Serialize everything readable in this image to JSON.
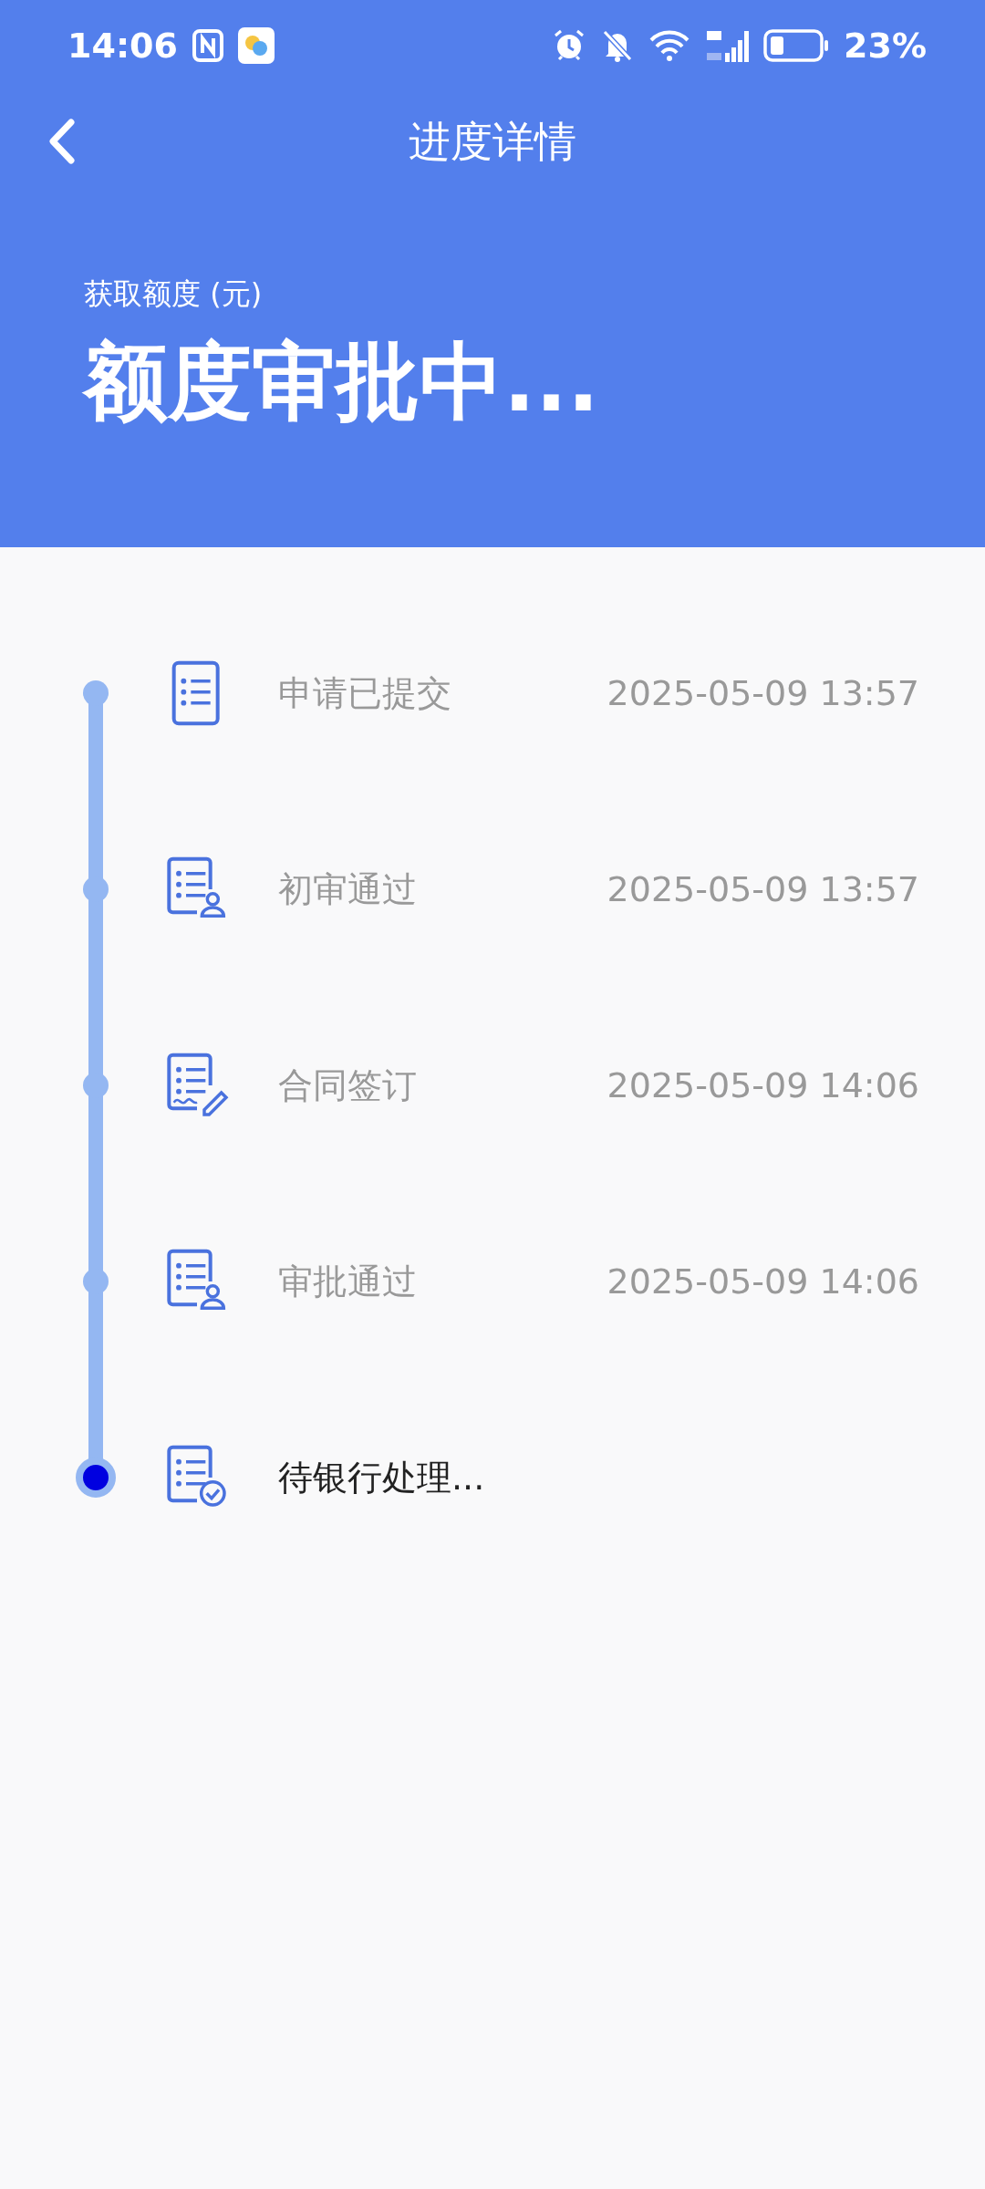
{
  "status_bar": {
    "time": "14:06",
    "battery": "23%"
  },
  "header": {
    "title": "进度详情",
    "label": "获取额度 (元)",
    "status": "额度审批中..."
  },
  "steps": [
    {
      "kind": "list",
      "title": "申请已提交",
      "time": "2025-05-09 13:57",
      "current": false
    },
    {
      "kind": "person",
      "title": "初审通过",
      "time": "2025-05-09 13:57",
      "current": false
    },
    {
      "kind": "sign",
      "title": "合同签订",
      "time": "2025-05-09 14:06",
      "current": false
    },
    {
      "kind": "person",
      "title": "审批通过",
      "time": "2025-05-09 14:06",
      "current": false
    },
    {
      "kind": "check",
      "title": "待银行处理...",
      "current": true
    }
  ]
}
